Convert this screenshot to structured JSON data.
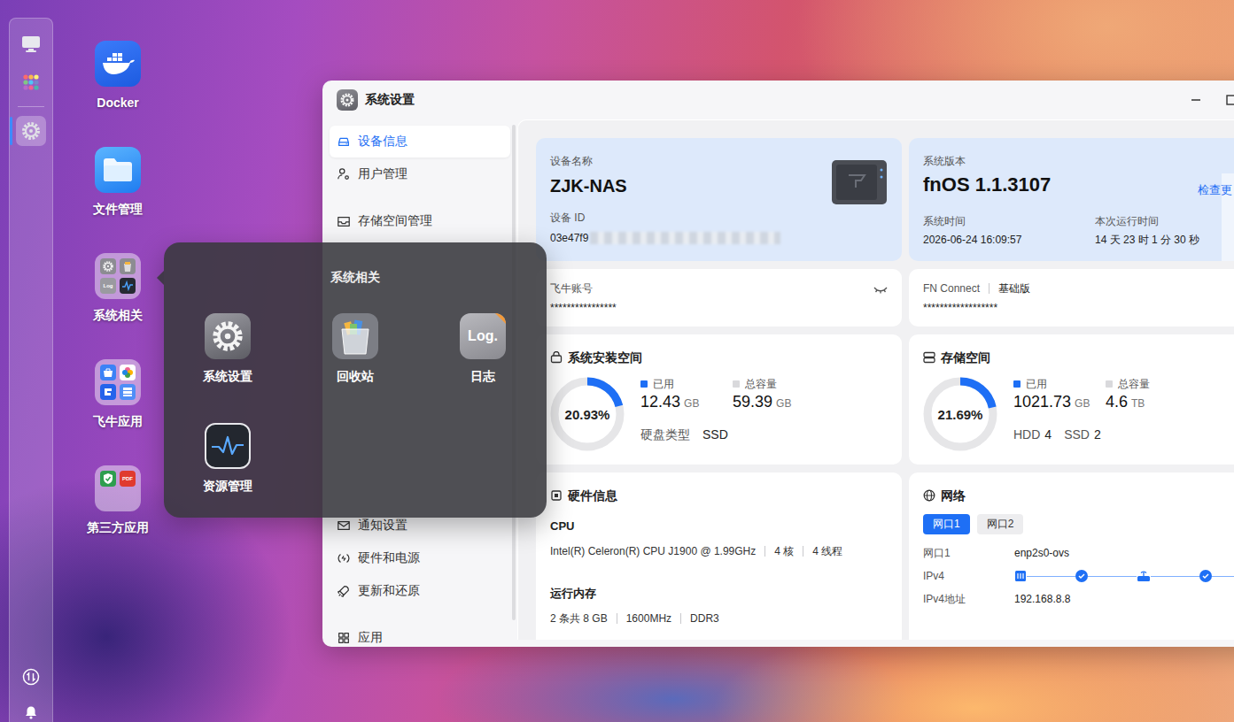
{
  "dock": {
    "items": [
      {
        "selected": false
      },
      {
        "selected": false
      },
      {
        "selected": true
      }
    ]
  },
  "desktop_icons": [
    {
      "label": "Docker",
      "kind": "docker"
    },
    {
      "label": "文件管理",
      "kind": "files"
    },
    {
      "label": "系统相关",
      "kind": "folder",
      "open": true,
      "apps": [
        {
          "kind": "gear"
        },
        {
          "kind": "trash"
        },
        {
          "kind": "log",
          "text": "Log"
        },
        {
          "kind": "chart"
        }
      ]
    },
    {
      "label": "飞牛应用",
      "kind": "folder",
      "open": false,
      "apps": [
        {
          "kind": "store"
        },
        {
          "kind": "flower"
        },
        {
          "kind": "app"
        },
        {
          "kind": "grid"
        }
      ]
    },
    {
      "label": "第三方应用",
      "kind": "folder",
      "open": false,
      "apps": [
        {
          "kind": "shield"
        },
        {
          "kind": "pdf",
          "text": "PDF"
        }
      ]
    }
  ],
  "popup": {
    "title": "系统相关",
    "apps": [
      {
        "label": "系统设置",
        "kind": "settings"
      },
      {
        "label": "回收站",
        "kind": "trash"
      },
      {
        "label": "日志",
        "kind": "log",
        "text": "Log."
      },
      {
        "label": "资源管理",
        "kind": "monitor"
      }
    ]
  },
  "window": {
    "title": "系统设置"
  },
  "sidebar": {
    "items": [
      {
        "label": "设备信息",
        "selected": true
      },
      {
        "label": "用户管理",
        "selected": false
      },
      {
        "label": "存储空间管理",
        "selected": false
      },
      {
        "label": "通知设置",
        "selected": false
      },
      {
        "label": "硬件和电源",
        "selected": false
      },
      {
        "label": "更新和还原",
        "selected": false
      },
      {
        "label": "应用",
        "selected": false
      }
    ]
  },
  "device": {
    "name_label": "设备名称",
    "name": "ZJK-NAS",
    "id_label": "设备 ID",
    "id": "03e47f9",
    "id_masked": true
  },
  "system": {
    "version_label": "系统版本",
    "version": "fnOS 1.1.3107",
    "check_update": "检查更",
    "time_label": "系统时间",
    "time": "2026-06-24 16:09:57",
    "uptime_label": "本次运行时间",
    "uptime": "14 天 23 时 1 分 30 秒"
  },
  "account": {
    "label": "飞牛账号",
    "value": "****************"
  },
  "connect": {
    "label": "FN Connect",
    "plan": "基础版",
    "value": "******************"
  },
  "system_storage": {
    "title": "系统安装空间",
    "level": 0.2093,
    "percent": "20.93%",
    "used_label": "已用",
    "used": "12.43",
    "used_unit": "GB",
    "total_label": "总容量",
    "total": "59.39",
    "total_unit": "GB",
    "disk_type_label": "硬盘类型",
    "disk_type": "SSD"
  },
  "storage": {
    "title": "存储空间",
    "level": 0.2169,
    "percent": "21.69%",
    "used_label": "已用",
    "used": "1021.73",
    "used_unit": "GB",
    "total_label": "总容量",
    "total": "4.6",
    "total_unit": "TB",
    "disks": [
      {
        "type": "HDD",
        "count": "4"
      },
      {
        "type": "SSD",
        "count": "2"
      }
    ]
  },
  "hardware": {
    "title": "硬件信息",
    "cpu_label": "CPU",
    "cpu": [
      "Intel(R) Celeron(R) CPU J1900 @ 1.99GHz",
      "4 核",
      "4 线程"
    ],
    "memory_label": "运行内存",
    "memory": [
      "2 条共 8 GB",
      "1600MHz",
      "DDR3"
    ]
  },
  "network": {
    "title": "网络",
    "tabs": [
      {
        "label": "网口1",
        "selected": true
      },
      {
        "label": "网口2",
        "selected": false
      }
    ],
    "rows": [
      {
        "label": "网口1",
        "kind": "text",
        "value": "enp2s0-ovs"
      },
      {
        "label": "IPv4",
        "kind": "status",
        "links": [
          {
            "ok": true
          },
          {
            "ok": true
          }
        ]
      },
      {
        "label": "IPv4地址",
        "kind": "text",
        "value": "192.168.8.8"
      }
    ]
  }
}
